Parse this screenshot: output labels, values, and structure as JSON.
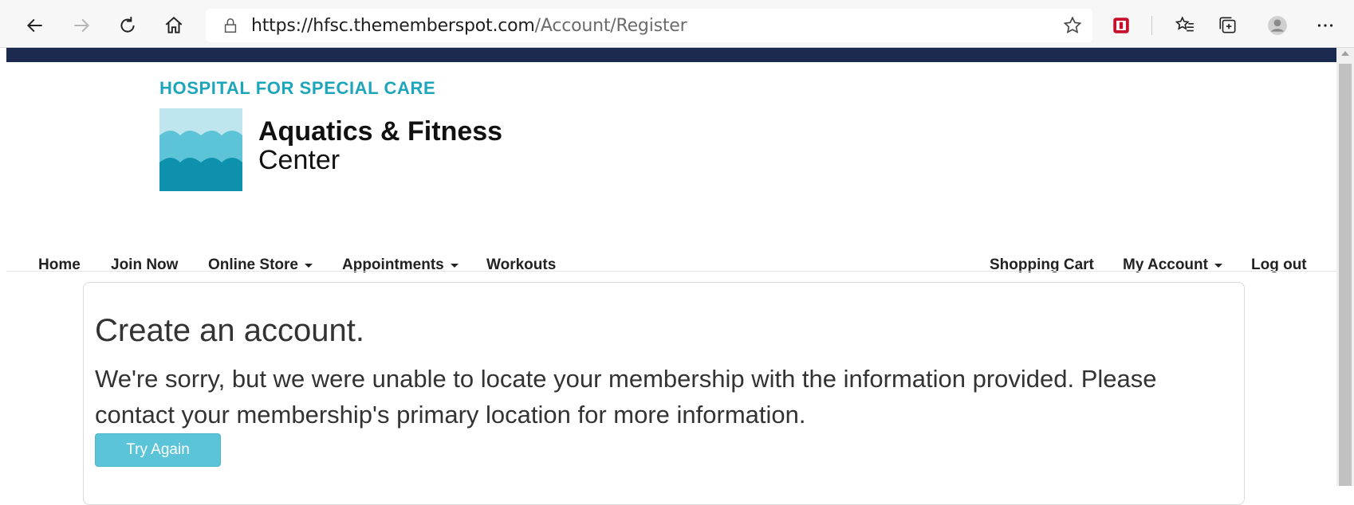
{
  "browser": {
    "url_host": "https://hfsc.thememberspot.com",
    "url_path": "/Account/Register",
    "icons": [
      "back-icon",
      "forward-icon",
      "refresh-icon",
      "home-icon",
      "lock-icon",
      "favorite-star-icon",
      "extension-icon",
      "favorites-icon",
      "collections-icon",
      "profile-icon",
      "more-icon"
    ]
  },
  "header": {
    "tagline": "HOSPITAL FOR SPECIAL CARE",
    "brand_line1": "Aquatics & Fitness",
    "brand_line2": "Center",
    "band_color": "#1c2a50",
    "tagline_color": "#1da5bb"
  },
  "nav": {
    "left": [
      {
        "label": "Home"
      },
      {
        "label": "Join Now"
      },
      {
        "label": "Online Store"
      },
      {
        "label": "Appointments"
      },
      {
        "label": "Workouts"
      }
    ],
    "right": [
      {
        "label": "Shopping Cart"
      },
      {
        "label": "My Account"
      },
      {
        "label": "Log out"
      }
    ]
  },
  "content": {
    "title": "Create an account.",
    "message": "We're sorry, but we were unable to locate your membership with the information provided. Please contact your membership's primary location for more information.",
    "button_label": "Try Again",
    "button_color": "#5bc4d8"
  }
}
